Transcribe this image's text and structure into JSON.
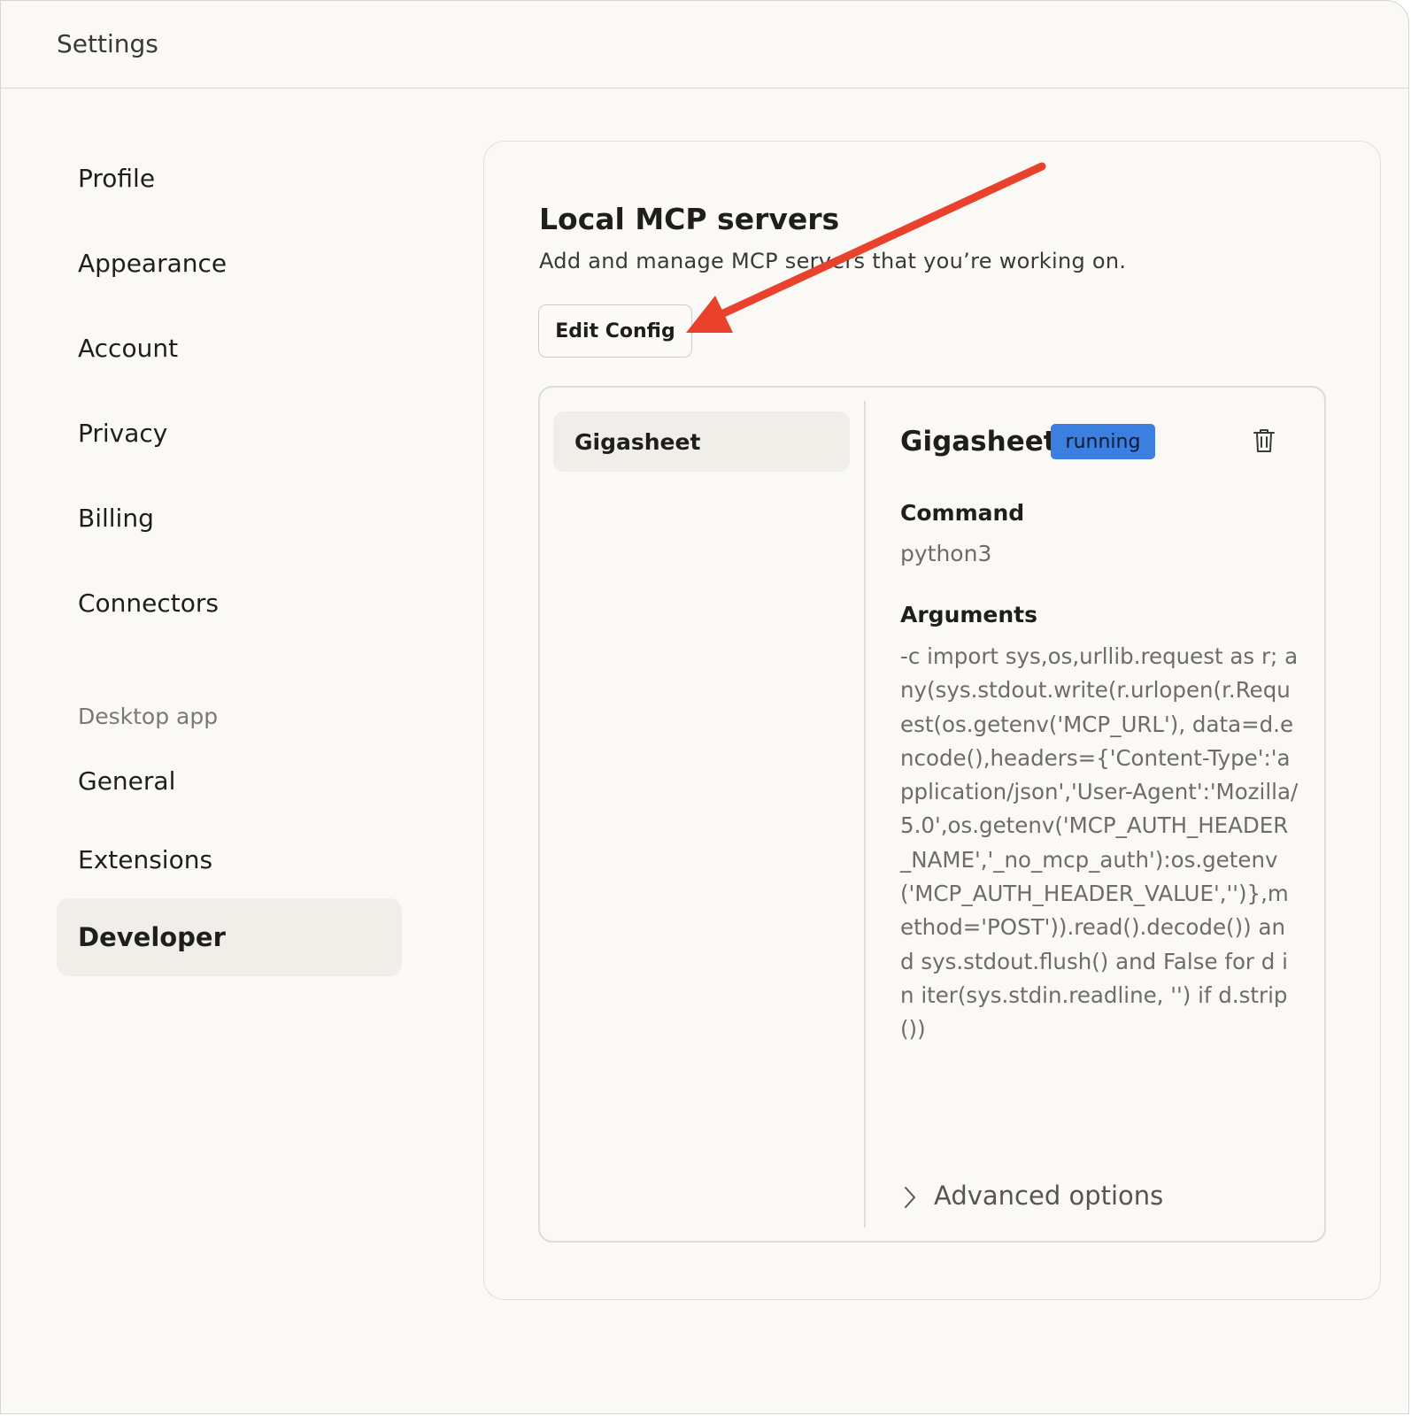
{
  "window": {
    "title": "Settings"
  },
  "sidebar": {
    "items": [
      {
        "label": "Profile"
      },
      {
        "label": "Appearance"
      },
      {
        "label": "Account"
      },
      {
        "label": "Privacy"
      },
      {
        "label": "Billing"
      },
      {
        "label": "Connectors"
      }
    ],
    "section_label": "Desktop app",
    "desktop_items": [
      {
        "label": "General"
      },
      {
        "label": "Extensions"
      },
      {
        "label": "Developer",
        "active": true
      }
    ]
  },
  "main": {
    "title": "Local MCP servers",
    "subtitle": "Add and manage MCP servers that you’re working on.",
    "edit_button": "Edit Config",
    "servers": [
      {
        "name": "Gigasheet"
      }
    ],
    "detail": {
      "name": "Gigasheet",
      "status": "running",
      "command_label": "Command",
      "command": "python3",
      "arguments_label": "Arguments",
      "arguments": "-c import sys,os,urllib.request as r; any(sys.stdout.write(r.urlopen(r.Request(os.getenv('MCP_URL'), data=d.encode(),headers={'Content-Type':'application/json','User-Agent':'Mozilla/5.0',os.getenv('MCP_AUTH_HEADER_NAME','_no_mcp_auth'):os.getenv('MCP_AUTH_HEADER_VALUE','')},method='POST')).read().decode()) and sys.stdout.flush() and False for d in iter(sys.stdin.readline, '') if d.strip())",
      "advanced_label": "Advanced options"
    }
  },
  "colors": {
    "background": "#faf9f6",
    "active_nav": "#f0eee8",
    "badge": "#3b7fe0",
    "annotation_arrow": "#e8412c"
  },
  "icons": {
    "trash": "trash-icon",
    "advanced_chevron": "chevron-right-icon",
    "annotation": "red-arrow-annotation"
  }
}
